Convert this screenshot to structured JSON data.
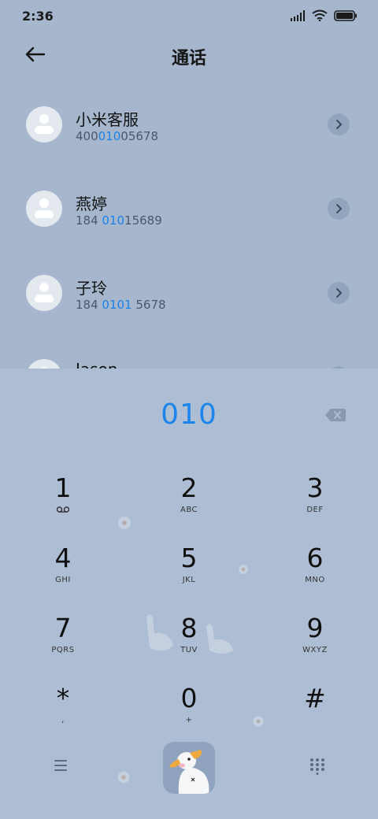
{
  "status_bar": {
    "time": "2:36"
  },
  "header": {
    "title": "通话"
  },
  "contacts": [
    {
      "name": "小米客服",
      "number_parts": [
        "400",
        "010",
        "05678"
      ]
    },
    {
      "name": "燕婷",
      "number_parts": [
        "184 ",
        "010",
        "15689"
      ]
    },
    {
      "name": "子玲",
      "number_parts": [
        "184 ",
        "0101",
        " 5678"
      ]
    },
    {
      "name": "Jason",
      "number_parts": [
        "",
        "",
        ""
      ]
    }
  ],
  "dialer": {
    "input": "010",
    "keys": [
      {
        "digit": "1",
        "letters": ""
      },
      {
        "digit": "2",
        "letters": "ABC"
      },
      {
        "digit": "3",
        "letters": "DEF"
      },
      {
        "digit": "4",
        "letters": "GHI"
      },
      {
        "digit": "5",
        "letters": "JKL"
      },
      {
        "digit": "6",
        "letters": "MNO"
      },
      {
        "digit": "7",
        "letters": "PQRS"
      },
      {
        "digit": "8",
        "letters": "TUV"
      },
      {
        "digit": "9",
        "letters": "WXYZ"
      },
      {
        "digit": "*",
        "letters": ","
      },
      {
        "digit": "0",
        "letters": "+"
      },
      {
        "digit": "#",
        "letters": ""
      }
    ]
  },
  "icons": {
    "back": "arrow-left-icon",
    "voicemail": "voicemail-icon",
    "backspace": "backspace-icon",
    "menu": "menu-icon",
    "call": "call-icon",
    "keypad": "keypad-icon",
    "detail": "chevron-right-icon"
  },
  "colors": {
    "accent": "#1c85ec",
    "background": "#a5b6cd"
  }
}
